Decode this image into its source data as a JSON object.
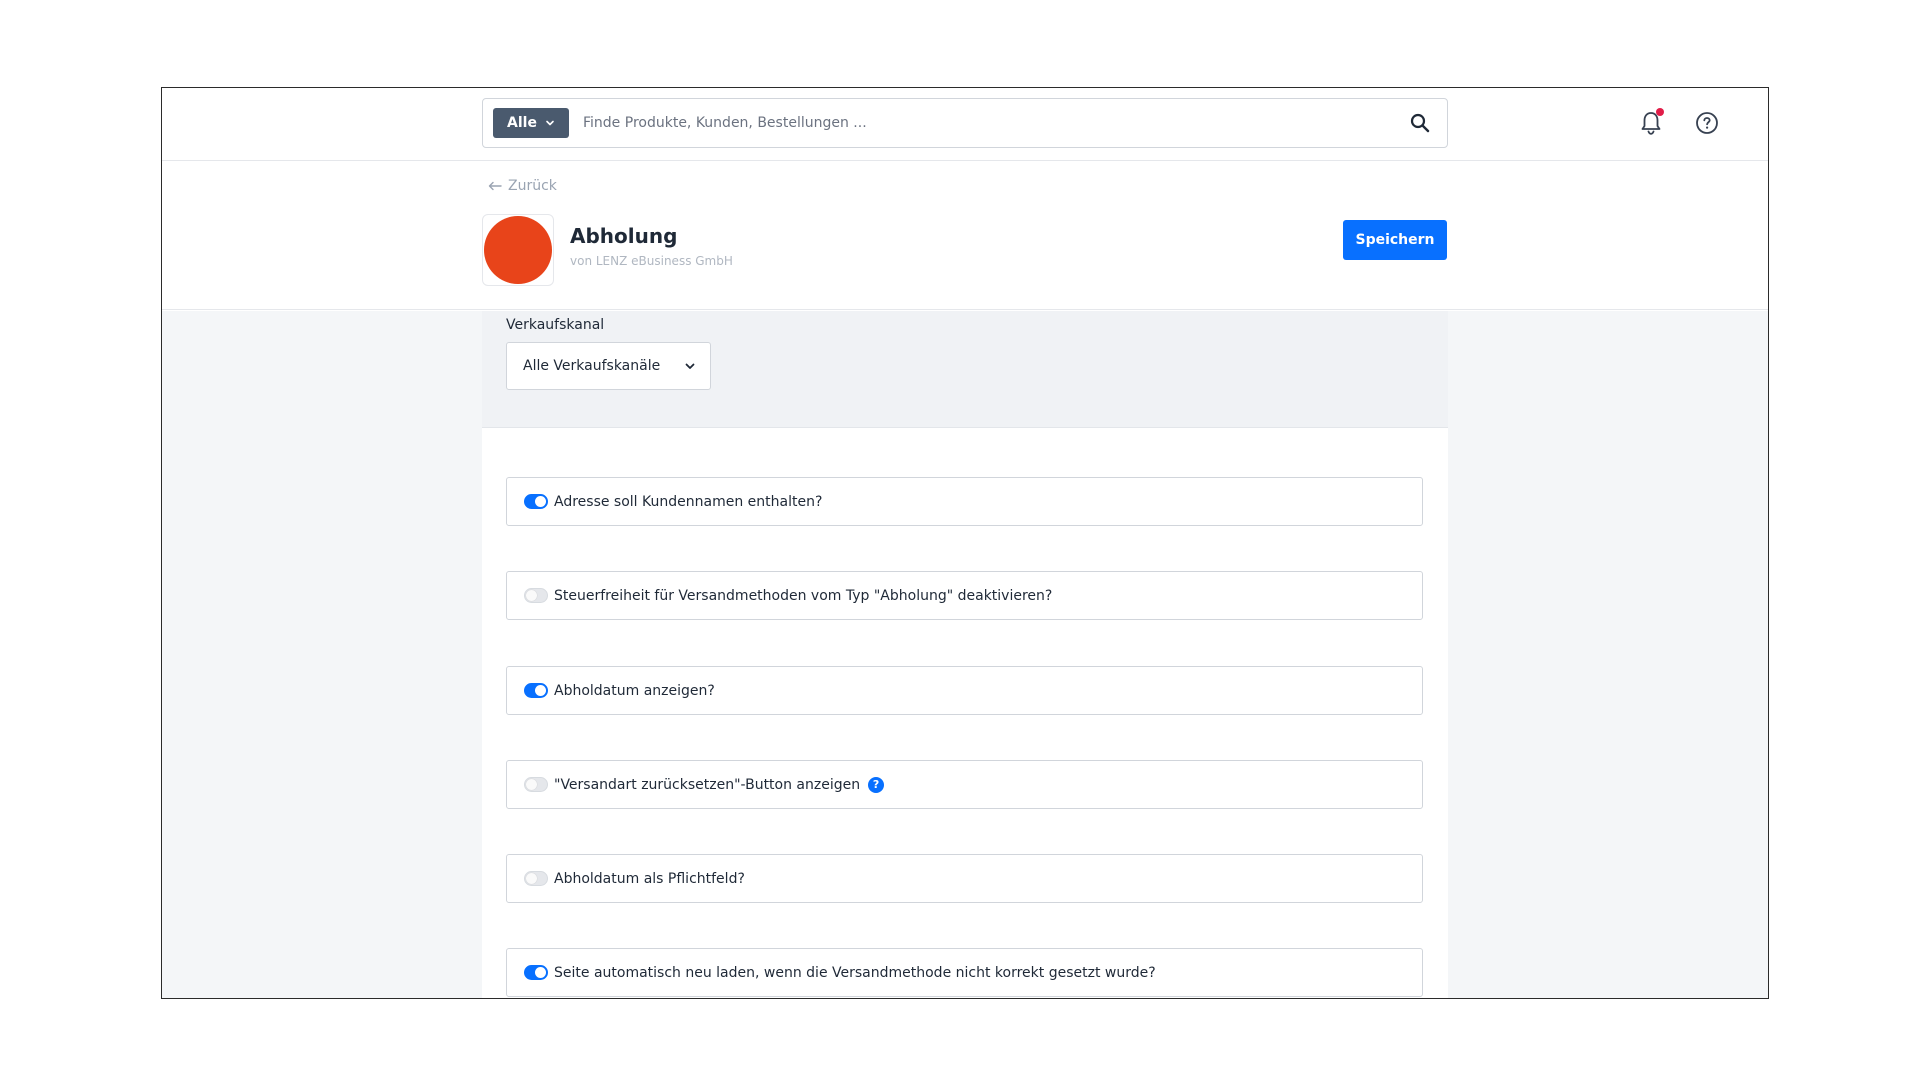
{
  "search": {
    "scope_label": "Alle",
    "placeholder": "Finde Produkte, Kunden, Bestellungen ...",
    "value": ""
  },
  "header": {
    "back_label": "Zurück",
    "app_title": "Abholung",
    "vendor": "von LENZ eBusiness GmbH",
    "save_label": "Speichern",
    "logo_color": "#e8441a"
  },
  "channel": {
    "label": "Verkaufskanal",
    "selected": "Alle Verkaufskanäle"
  },
  "options": [
    {
      "label": "Adresse soll Kundennamen enthalten?",
      "enabled": true
    },
    {
      "label": "Steuerfreiheit für Versandmethoden vom Typ \"Abholung\" deaktivieren?",
      "enabled": false
    },
    {
      "label": "Abholdatum anzeigen?",
      "enabled": true
    },
    {
      "label": "\"Versandart zurücksetzen\"-Button anzeigen",
      "enabled": false,
      "info_icon": "?"
    },
    {
      "label": "Abholdatum als Pflichtfeld?",
      "enabled": false
    },
    {
      "label": "Seite automatisch neu laden, wenn die Versandmethode nicht korrekt gesetzt wurde?",
      "enabled": true
    }
  ],
  "colors": {
    "accent": "#0870ff",
    "scope_bg": "#4a5a6e",
    "notification_dot": "#e11d48"
  },
  "icons": {
    "search": "search-icon",
    "notifications": "bell-icon",
    "help": "help-circle-icon",
    "back": "arrow-left-icon",
    "dropdown": "chevron-down-icon"
  }
}
